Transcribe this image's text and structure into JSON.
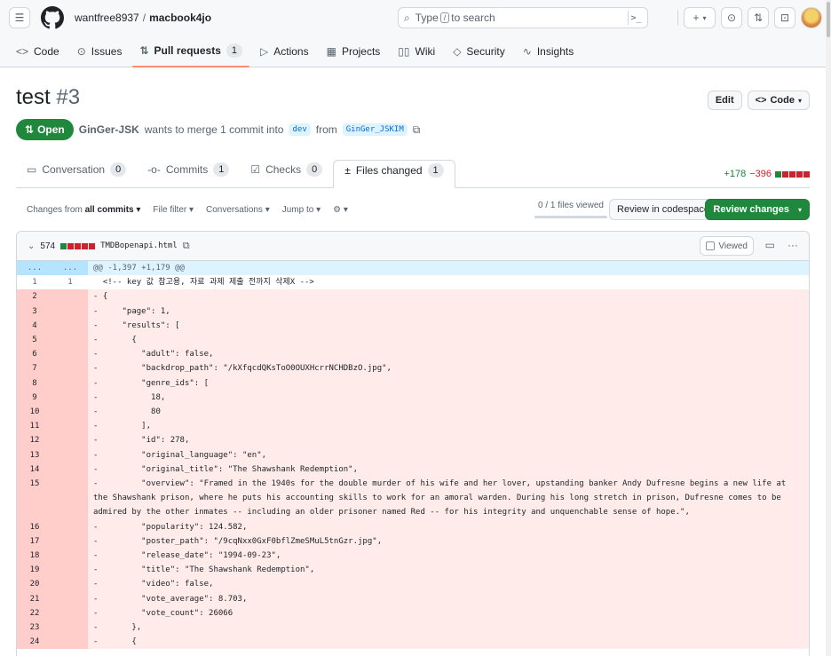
{
  "header": {
    "owner": "wantfree8937",
    "separator": "/",
    "repo": "macbook4jo",
    "search_prefix": "Type",
    "search_key": "/",
    "search_suffix": "to search"
  },
  "repo_nav": [
    {
      "label": "Code",
      "icon": "code-icon",
      "glyph": "<>"
    },
    {
      "label": "Issues",
      "icon": "issue-icon",
      "glyph": "⊙"
    },
    {
      "label": "Pull requests",
      "icon": "pull-request-icon",
      "glyph": "⇅",
      "count": "1",
      "active": true
    },
    {
      "label": "Actions",
      "icon": "play-icon",
      "glyph": "▷"
    },
    {
      "label": "Projects",
      "icon": "table-icon",
      "glyph": "▦"
    },
    {
      "label": "Wiki",
      "icon": "book-icon",
      "glyph": "▯▯"
    },
    {
      "label": "Security",
      "icon": "shield-icon",
      "glyph": "◇"
    },
    {
      "label": "Insights",
      "icon": "graph-icon",
      "glyph": "∿"
    }
  ],
  "pr": {
    "title": "test",
    "number": "#3",
    "edit_label": "Edit",
    "code_label": "Code",
    "state": "Open",
    "author": "GinGer-JSK",
    "meta_text": "wants to merge 1 commit into",
    "base_branch": "dev",
    "from_text": "from",
    "head_branch": "GinGer_JSKIM"
  },
  "pr_tabs": [
    {
      "label": "Conversation",
      "count": "0",
      "icon": "comment-icon",
      "glyph": "▭"
    },
    {
      "label": "Commits",
      "count": "1",
      "icon": "commit-icon",
      "glyph": "-o-"
    },
    {
      "label": "Checks",
      "count": "0",
      "icon": "checklist-icon",
      "glyph": "☑"
    },
    {
      "label": "Files changed",
      "count": "1",
      "icon": "file-diff-icon",
      "glyph": "±",
      "active": true
    }
  ],
  "diffstat": {
    "additions": "+178",
    "deletions": "−396"
  },
  "toolbar": {
    "changes_prefix": "Changes from",
    "changes_value": "all commits ▾",
    "file_filter": "File filter ▾",
    "conversations": "Conversations ▾",
    "jump_to": "Jump to ▾",
    "settings": "⚙ ▾",
    "files_viewed": "0 / 1 files viewed",
    "review_codespace": "Review in codespace",
    "review_changes": "Review changes"
  },
  "file": {
    "change_count": "574",
    "name": "TMDBopenapi.html",
    "viewed_label": "Viewed"
  },
  "diff_lines": [
    {
      "type": "hunk",
      "old": "...",
      "new": "...",
      "text": "@@ -1,397 +1,179 @@"
    },
    {
      "type": "ctx",
      "old": "1",
      "new": "1",
      "text": "  <!-- key 값 참고용, 자료 과제 제출 전까지 삭제X -->"
    },
    {
      "type": "del",
      "old": "2",
      "new": "",
      "text": "- {"
    },
    {
      "type": "del",
      "old": "3",
      "new": "",
      "text": "-     \"page\": 1,"
    },
    {
      "type": "del",
      "old": "4",
      "new": "",
      "text": "-     \"results\": ["
    },
    {
      "type": "del",
      "old": "5",
      "new": "",
      "text": "-       {"
    },
    {
      "type": "del",
      "old": "6",
      "new": "",
      "text": "-         \"adult\": false,"
    },
    {
      "type": "del",
      "old": "7",
      "new": "",
      "text": "-         \"backdrop_path\": \"/kXfqcdQKsToO0OUXHcrrNCHDBzO.jpg\","
    },
    {
      "type": "del",
      "old": "8",
      "new": "",
      "text": "-         \"genre_ids\": ["
    },
    {
      "type": "del",
      "old": "9",
      "new": "",
      "text": "-           18,"
    },
    {
      "type": "del",
      "old": "10",
      "new": "",
      "text": "-           80"
    },
    {
      "type": "del",
      "old": "11",
      "new": "",
      "text": "-         ],"
    },
    {
      "type": "del",
      "old": "12",
      "new": "",
      "text": "-         \"id\": 278,"
    },
    {
      "type": "del",
      "old": "13",
      "new": "",
      "text": "-         \"original_language\": \"en\","
    },
    {
      "type": "del",
      "old": "14",
      "new": "",
      "text": "-         \"original_title\": \"The Shawshank Redemption\","
    },
    {
      "type": "del",
      "old": "15",
      "new": "",
      "text": "-         \"overview\": \"Framed in the 1940s for the double murder of his wife and her lover, upstanding banker Andy Dufresne begins a new life at the Shawshank prison, where he puts his accounting skills to work for an amoral warden. During his long stretch in prison, Dufresne comes to be admired by the other inmates -- including an older prisoner named Red -- for his integrity and unquenchable sense of hope.\","
    },
    {
      "type": "del",
      "old": "16",
      "new": "",
      "text": "-         \"popularity\": 124.582,"
    },
    {
      "type": "del",
      "old": "17",
      "new": "",
      "text": "-         \"poster_path\": \"/9cqNxx0GxF0bflZmeSMuL5tnGzr.jpg\","
    },
    {
      "type": "del",
      "old": "18",
      "new": "",
      "text": "-         \"release_date\": \"1994-09-23\","
    },
    {
      "type": "del",
      "old": "19",
      "new": "",
      "text": "-         \"title\": \"The Shawshank Redemption\","
    },
    {
      "type": "del",
      "old": "20",
      "new": "",
      "text": "-         \"video\": false,"
    },
    {
      "type": "del",
      "old": "21",
      "new": "",
      "text": "-         \"vote_average\": 8.703,"
    },
    {
      "type": "del",
      "old": "22",
      "new": "",
      "text": "-         \"vote_count\": 26066"
    },
    {
      "type": "del",
      "old": "23",
      "new": "",
      "text": "-       },"
    },
    {
      "type": "del",
      "old": "24",
      "new": "",
      "text": "-       {"
    }
  ],
  "colors": {
    "open_state": "#1f883d",
    "deletion_bg": "#ffebe9",
    "hunk_bg": "#ddf4ff",
    "active_tab_underline": "#fd8c73"
  }
}
